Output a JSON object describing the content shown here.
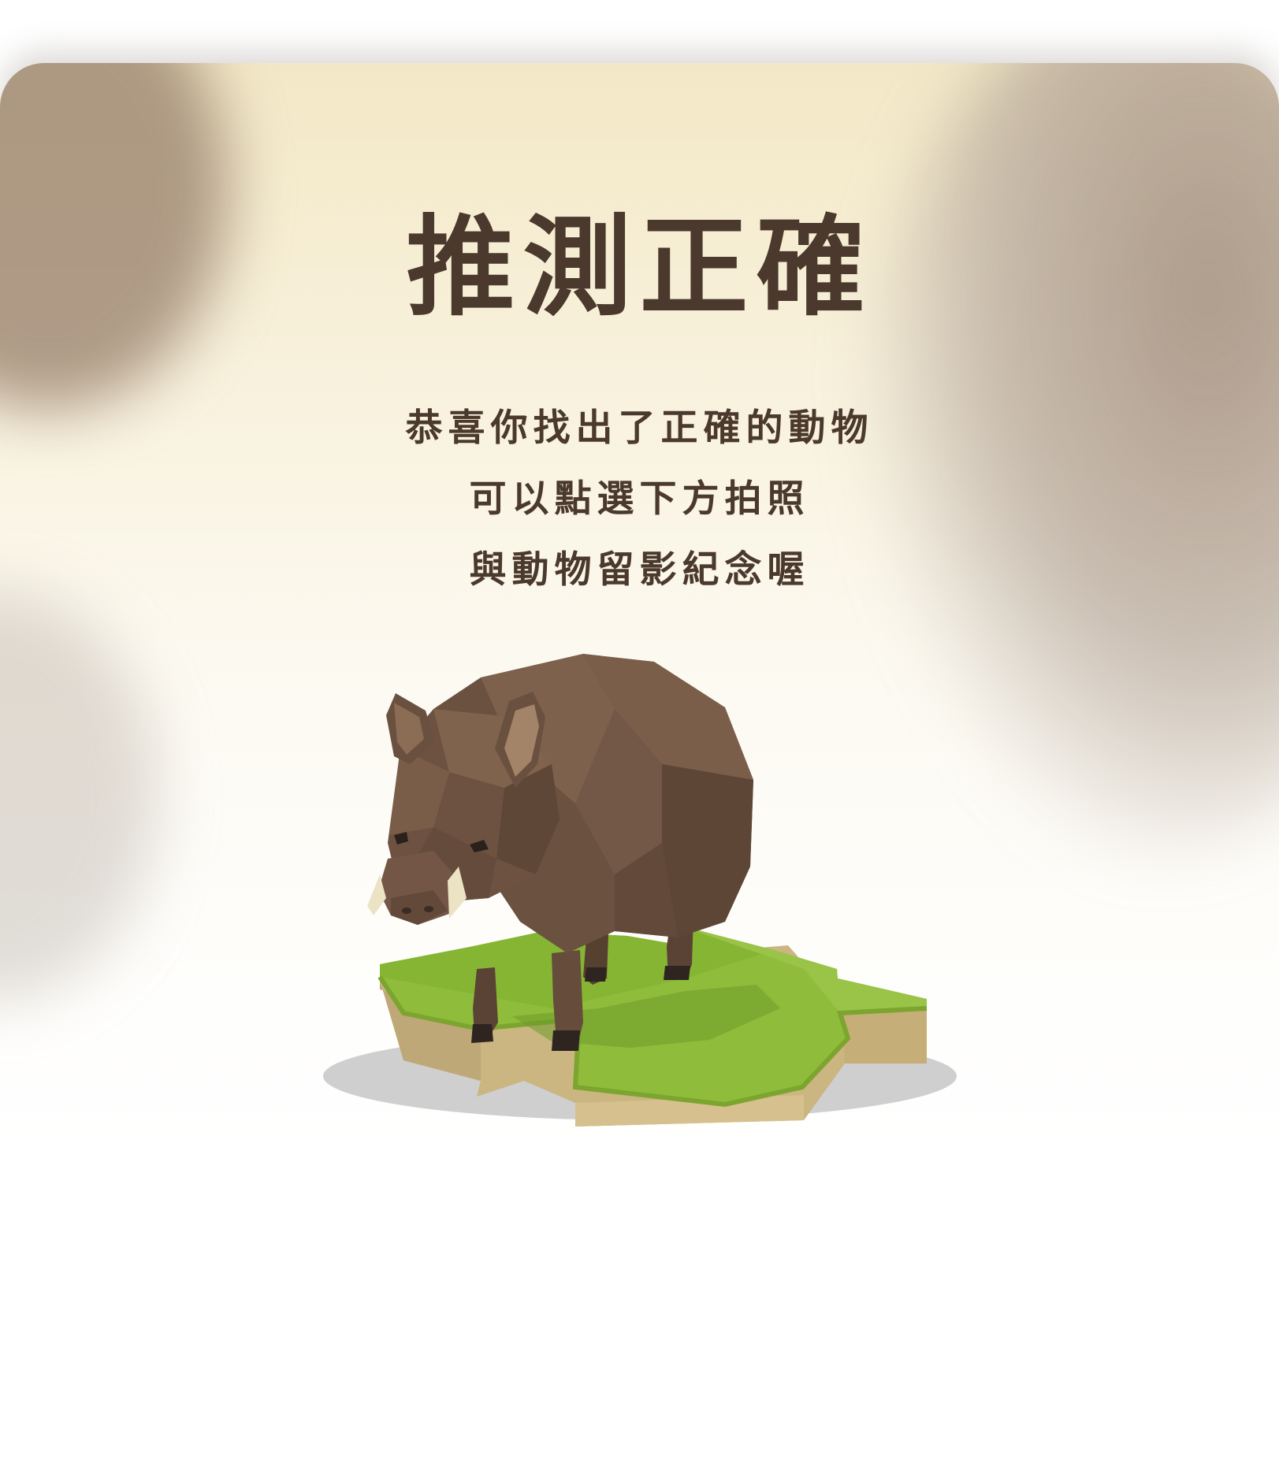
{
  "result": {
    "title": "推測正確",
    "message_lines": [
      "恭喜你找出了正確的動物",
      "可以點選下方拍照",
      "與動物留影紀念喔"
    ]
  },
  "animal": {
    "icon": "wild-boar-icon"
  },
  "colors": {
    "text": "#4a392c",
    "grass": "#8fbc3b",
    "soil": "#cbb580",
    "boar": "#6b5140"
  }
}
